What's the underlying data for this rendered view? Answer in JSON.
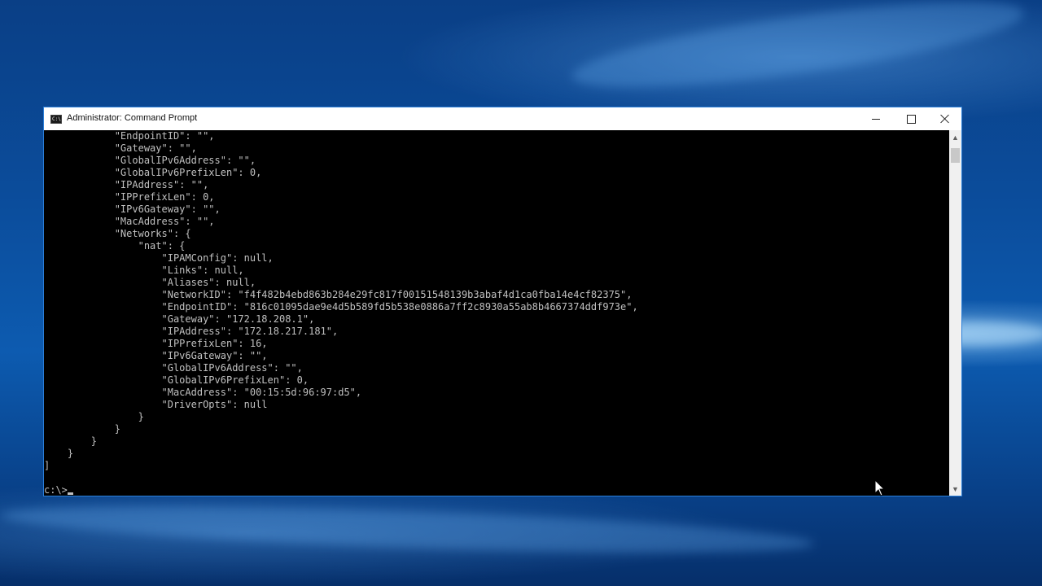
{
  "window": {
    "title": "Administrator: Command Prompt",
    "icon": "cmd-icon",
    "controls": {
      "minimize": "minimize-icon",
      "maximize": "maximize-icon",
      "close": "close-icon"
    }
  },
  "console": {
    "lines": [
      "            \"EndpointID\": \"\",",
      "            \"Gateway\": \"\",",
      "            \"GlobalIPv6Address\": \"\",",
      "            \"GlobalIPv6PrefixLen\": 0,",
      "            \"IPAddress\": \"\",",
      "            \"IPPrefixLen\": 0,",
      "            \"IPv6Gateway\": \"\",",
      "            \"MacAddress\": \"\",",
      "            \"Networks\": {",
      "                \"nat\": {",
      "                    \"IPAMConfig\": null,",
      "                    \"Links\": null,",
      "                    \"Aliases\": null,",
      "                    \"NetworkID\": \"f4f482b4ebd863b284e29fc817f00151548139b3abaf4d1ca0fba14e4cf82375\",",
      "                    \"EndpointID\": \"816c01095dae9e4d5b589fd5b538e0886a7ff2c8930a55ab8b4667374ddf973e\",",
      "                    \"Gateway\": \"172.18.208.1\",",
      "                    \"IPAddress\": \"172.18.217.181\",",
      "                    \"IPPrefixLen\": 16,",
      "                    \"IPv6Gateway\": \"\",",
      "                    \"GlobalIPv6Address\": \"\",",
      "                    \"GlobalIPv6PrefixLen\": 0,",
      "                    \"MacAddress\": \"00:15:5d:96:97:d5\",",
      "                    \"DriverOpts\": null",
      "                }",
      "            }",
      "        }",
      "    }",
      "]",
      ""
    ],
    "prompt": "c:\\>"
  }
}
